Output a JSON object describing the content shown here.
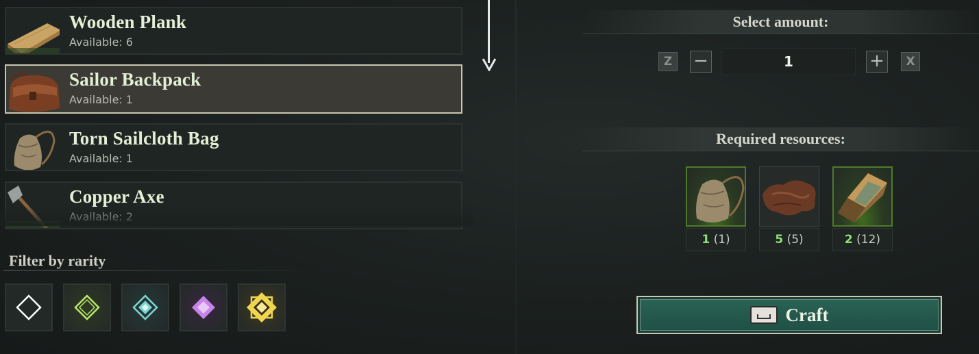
{
  "items": [
    {
      "name": "Wooden Plank",
      "available": "Available: 6",
      "icon": "wooden-plank-icon",
      "selected": false
    },
    {
      "name": "Sailor Backpack",
      "available": "Available: 1",
      "icon": "sailor-backpack-icon",
      "selected": true
    },
    {
      "name": "Torn Sailcloth Bag",
      "available": "Available: 1",
      "icon": "torn-sailcloth-bag-icon",
      "selected": false
    },
    {
      "name": "Copper Axe",
      "available": "Available: 2",
      "icon": "copper-axe-icon",
      "selected": false
    }
  ],
  "filter": {
    "title": "Filter by rarity",
    "rarities": [
      {
        "icon": "common-rarity-icon",
        "color": "#ffffff"
      },
      {
        "icon": "uncommon-rarity-icon",
        "color": "#b9e86a"
      },
      {
        "icon": "rare-rarity-icon",
        "color": "#7fd6d0"
      },
      {
        "icon": "epic-rarity-icon",
        "color": "#c784e8"
      },
      {
        "icon": "legendary-rarity-icon",
        "color": "#f0d650"
      }
    ]
  },
  "amount": {
    "title": "Select amount:",
    "value": "1",
    "key_decrease": "Z",
    "key_increase": "X",
    "minus": "−",
    "plus": "+"
  },
  "resources": {
    "title": "Required resources:",
    "items": [
      {
        "icon": "sailcloth-bag-icon",
        "have": "1",
        "need": "(1)"
      },
      {
        "icon": "animal-fur-icon",
        "have": "5",
        "need": "(5)"
      },
      {
        "icon": "copper-ingot-icon",
        "have": "2",
        "need": "(12)"
      }
    ]
  },
  "craft": {
    "label": "Craft",
    "key_icon": "spacebar-key-icon"
  },
  "colors": {
    "accent_green": "#8fe07a",
    "craft_button": "#2a6455",
    "selected_border": "#c9c6b2"
  }
}
